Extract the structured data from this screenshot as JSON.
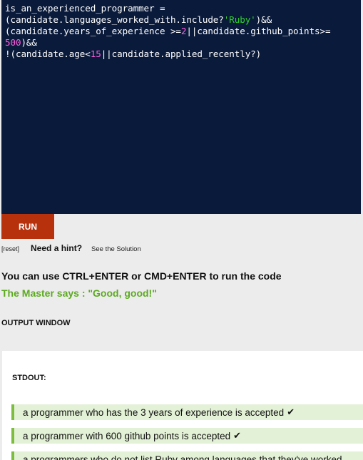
{
  "editor": {
    "code": {
      "line1": "is_an_experienced_programmer =",
      "line2_a": "(candidate.languages_worked_with.include?",
      "line2_str": "'Ruby'",
      "line2_b": ")&&",
      "line3_a": "(candidate.years_of_experience >=",
      "line3_num": "2",
      "line3_b": "||candidate.github_points>=",
      "line4_num": "500",
      "line4_b": ")&&",
      "line5_a": "!(candidate.age<",
      "line5_num": "15",
      "line5_b": "||candidate.applied_recently?)"
    }
  },
  "run_label": "RUN",
  "links": {
    "reset": "[reset]",
    "hint": "Need a hint?",
    "solution": "See the Solution"
  },
  "tip": "You can use CTRL+ENTER or CMD+ENTER to run the code",
  "master_says": "The Master says : \"Good, good!\"",
  "output": {
    "title": "OUTPUT WINDOW",
    "stdout_label": "STDOUT:",
    "results": [
      "a programmer who has the 3 years of experience is accepted",
      "a programmer with 600 github points is accepted",
      "a programmers who do not list Ruby among languages that they've worked"
    ],
    "check_glyph": "✔"
  },
  "colors": {
    "editor_bg": "#0a1a3b",
    "string": "#2fd32f",
    "number": "#ff5ee0",
    "run_button": "#b8310d",
    "master_text": "#5caa1f",
    "result_bg": "#e3f1d6",
    "result_border": "#7cbc3f"
  }
}
